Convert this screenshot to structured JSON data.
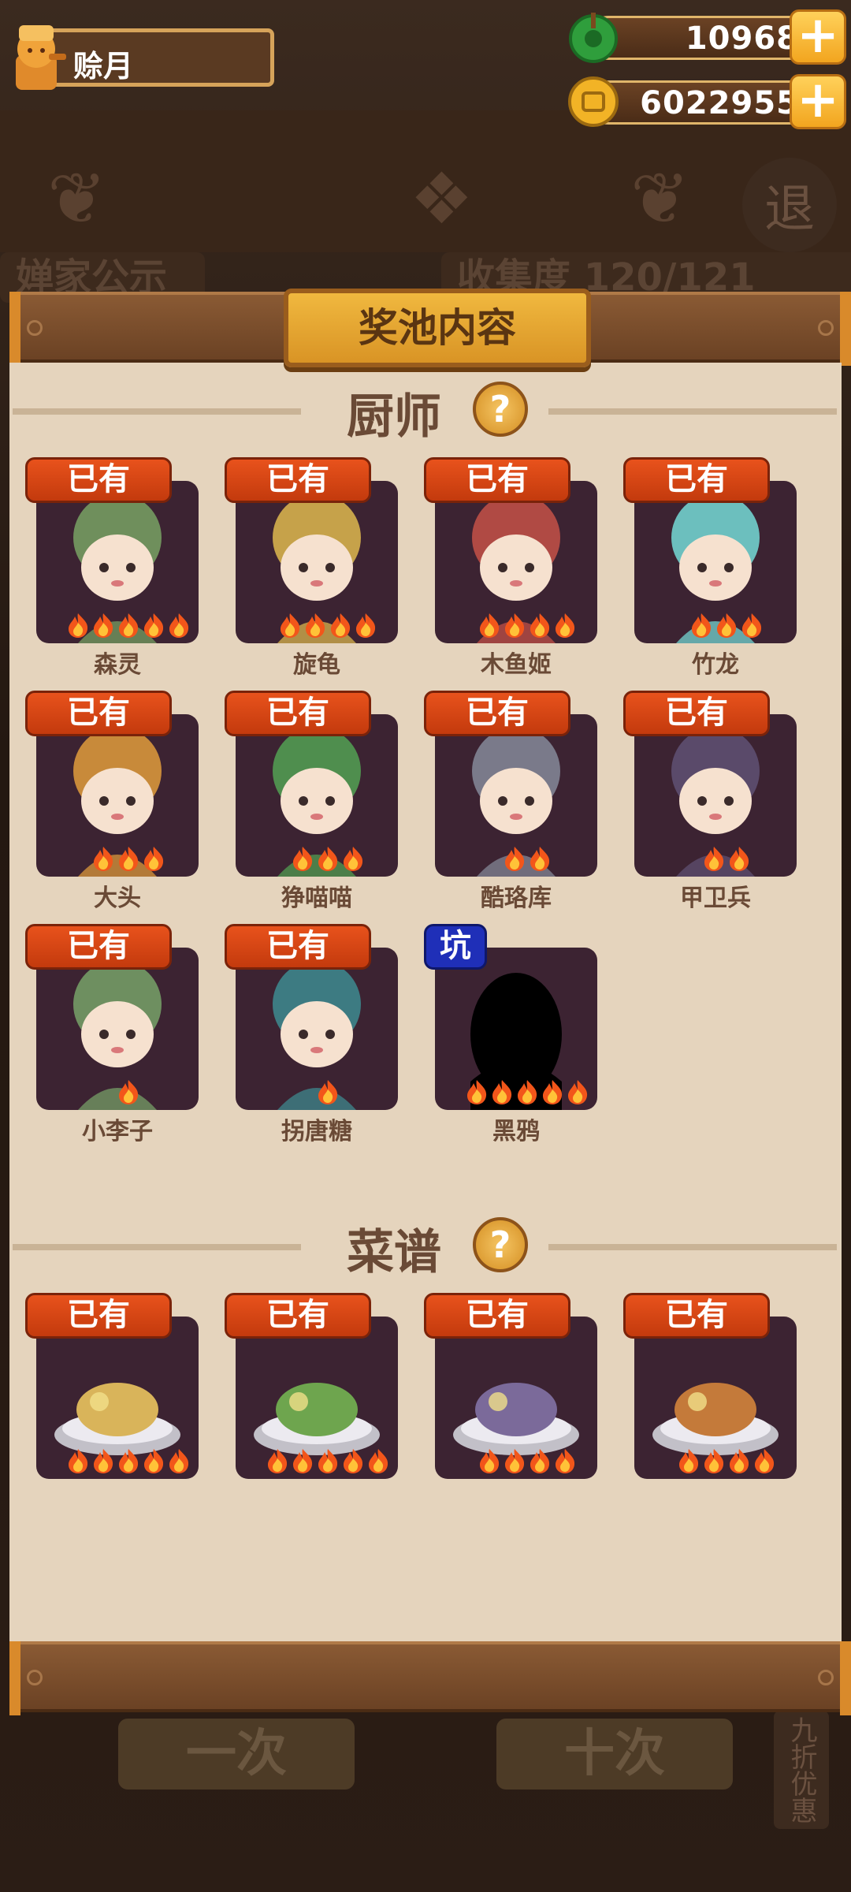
{
  "player": {
    "name": "赊月"
  },
  "currencies": [
    {
      "id": "jade",
      "value": "10968",
      "icon": "jade-coin-icon"
    },
    {
      "id": "gold",
      "value": "6022955",
      "icon": "gold-coin-icon"
    }
  ],
  "background": {
    "back_label": "退",
    "tab_left": "婵家公示",
    "tab_right": "收集度 120/121",
    "btn_one": "一次",
    "btn_ten": "十次",
    "side_tag": "九折优惠"
  },
  "modal": {
    "title": "奖池内容",
    "sections": [
      {
        "title": "厨师",
        "help": "?",
        "items": [
          {
            "name": "森灵",
            "badge": "已有",
            "flames": 5,
            "color": "#6f8f5c"
          },
          {
            "name": "旋龟",
            "badge": "已有",
            "flames": 4,
            "color": "#c6a24a"
          },
          {
            "name": "木鱼姬",
            "badge": "已有",
            "flames": 4,
            "color": "#b04a44"
          },
          {
            "name": "竹龙",
            "badge": "已有",
            "flames": 3,
            "color": "#6cbfbe"
          },
          {
            "name": "大头",
            "badge": "已有",
            "flames": 3,
            "color": "#c88a3a"
          },
          {
            "name": "狰喵喵",
            "badge": "已有",
            "flames": 3,
            "color": "#4f8e4e"
          },
          {
            "name": "酷珞库",
            "badge": "已有",
            "flames": 2,
            "color": "#7a7a8a"
          },
          {
            "name": "甲卫兵",
            "badge": "已有",
            "flames": 2,
            "color": "#5a4a6a"
          },
          {
            "name": "小李子",
            "badge": "已有",
            "flames": 1,
            "color": "#6e8f60"
          },
          {
            "name": "拐唐糖",
            "badge": "已有",
            "flames": 1,
            "color": "#3d7b82"
          },
          {
            "name": "黑鸦",
            "badge": "坑",
            "flames": 5,
            "color": "#000000"
          }
        ]
      },
      {
        "title": "菜谱",
        "help": "?",
        "items": [
          {
            "name": "",
            "badge": "已有",
            "flames": 5,
            "color": "#d9b45a"
          },
          {
            "name": "",
            "badge": "已有",
            "flames": 5,
            "color": "#6ea54e"
          },
          {
            "name": "",
            "badge": "已有",
            "flames": 4,
            "color": "#7b6a9a"
          },
          {
            "name": "",
            "badge": "已有",
            "flames": 4,
            "color": "#c47a3a"
          }
        ]
      }
    ]
  }
}
